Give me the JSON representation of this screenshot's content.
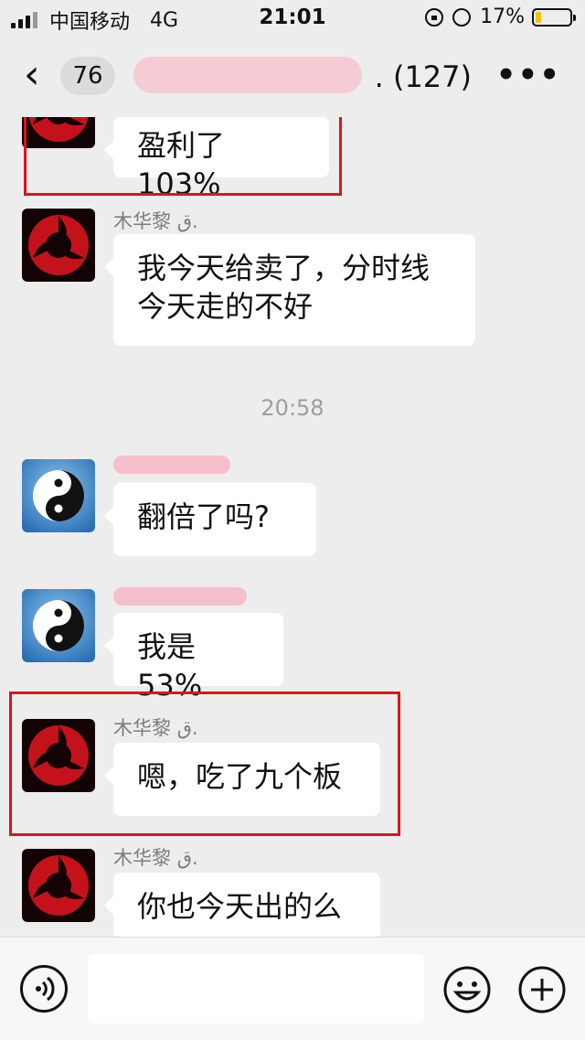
{
  "status_bar": {
    "carrier": "中国移动",
    "network": "4G",
    "time": "21:01",
    "battery_percent": "17%",
    "battery_level": 0.17
  },
  "nav": {
    "back_count": "76",
    "title_suffix": ". (127)",
    "more_label": "•••"
  },
  "messages": [
    {
      "sender": "",
      "text": "盈利了103%"
    },
    {
      "sender": "木华黎 ق.",
      "text_lines": [
        "我今天给卖了，分时线",
        "今天走的不好"
      ]
    },
    {
      "timestamp": "20:58"
    },
    {
      "sender": "",
      "text": "翻倍了吗?"
    },
    {
      "sender": "",
      "text": "我是53%"
    },
    {
      "sender": "木华黎 ق.",
      "text": "嗯，吃了九个板"
    },
    {
      "sender": "木华黎 ق.",
      "text": "你也今天出的么"
    }
  ],
  "colors": {
    "background": "#ededed",
    "bubble": "#ffffff",
    "highlight_box": "#d9161b",
    "redaction": "#f5b9c6",
    "battery": "#f2c200"
  },
  "icons": [
    "back-chevron-icon",
    "more-icon",
    "voice-icon",
    "emoji-icon",
    "plus-icon",
    "sharingan-avatar",
    "yin-yang-avatar"
  ]
}
